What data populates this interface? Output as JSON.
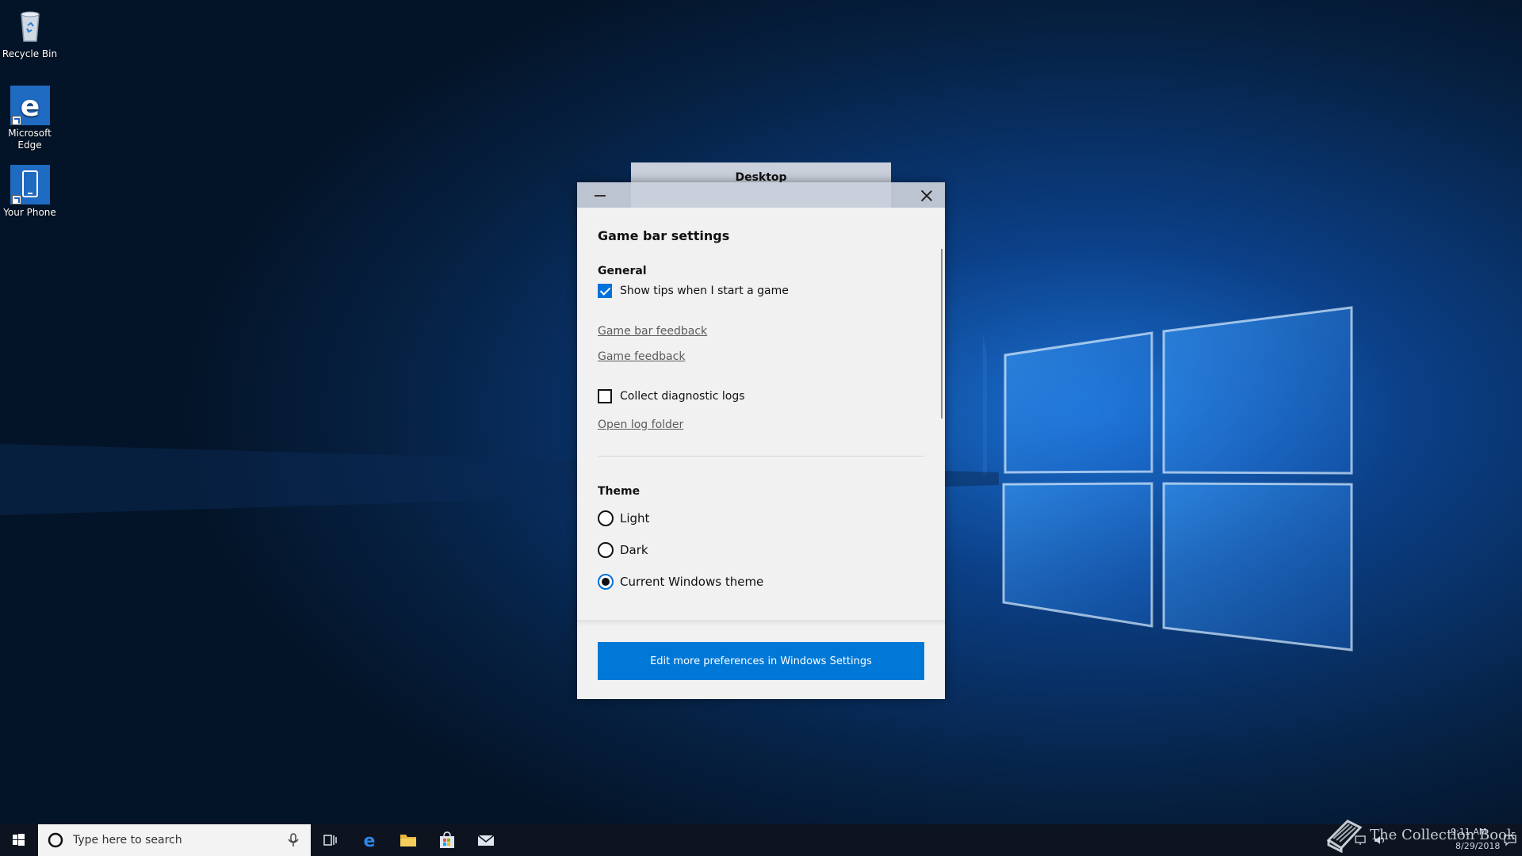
{
  "desktop": {
    "icons": [
      {
        "label": "Recycle Bin",
        "icon": "recycle-bin-icon"
      },
      {
        "label": "Microsoft Edge",
        "icon": "edge-icon"
      },
      {
        "label": "Your Phone",
        "icon": "phone-icon"
      }
    ]
  },
  "gamebar": {
    "desktop_tab_label": "Desktop",
    "menu_icon": "hamburger-icon",
    "close_icon": "close-icon",
    "title": "Game bar settings",
    "general": {
      "heading": "General",
      "show_tips_label": "Show tips when I start a game",
      "show_tips_checked": true,
      "links": [
        "Game bar feedback",
        "Game feedback"
      ],
      "collect_logs_label": "Collect diagnostic logs",
      "collect_logs_checked": false,
      "open_log_folder": "Open log folder"
    },
    "theme": {
      "heading": "Theme",
      "options": [
        "Light",
        "Dark",
        "Current Windows theme"
      ],
      "selected": "Current Windows theme"
    },
    "footer_button": "Edit more preferences in Windows Settings"
  },
  "taskbar": {
    "search_placeholder": "Type here to search",
    "pinned": [
      "task-view-icon",
      "edge-icon",
      "file-explorer-icon",
      "store-icon",
      "mail-icon"
    ],
    "time": "9:11 AM",
    "date": "8/29/2018"
  },
  "watermark": {
    "text": "The Collection Book"
  },
  "colors": {
    "accent": "#0078d7",
    "window_bg": "#f1f1f1",
    "titlebar": "#c9d0db",
    "taskbar": "#0d1420"
  }
}
